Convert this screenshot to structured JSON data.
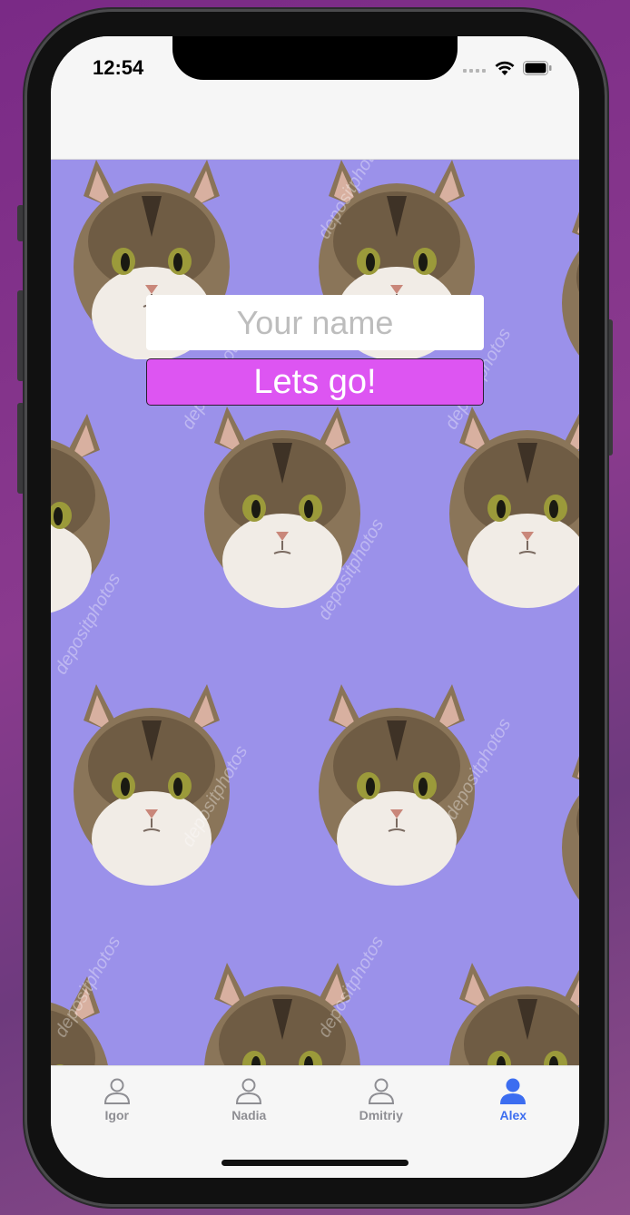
{
  "status_bar": {
    "time": "12:54"
  },
  "form": {
    "name_placeholder": "Your name",
    "name_value": "",
    "submit_label": "Lets go!"
  },
  "background": {
    "watermark_text": "depositphotos",
    "color": "#9b91ea"
  },
  "tabs": [
    {
      "label": "Igor",
      "icon": "person-outline-icon",
      "active": false
    },
    {
      "label": "Nadia",
      "icon": "person-outline-icon",
      "active": false
    },
    {
      "label": "Dmitriy",
      "icon": "person-outline-icon",
      "active": false
    },
    {
      "label": "Alex",
      "icon": "person-filled-icon",
      "active": true
    }
  ],
  "colors": {
    "accent": "#3c6df0",
    "button": "#dd55f2",
    "inactive": "#8e8e93"
  }
}
